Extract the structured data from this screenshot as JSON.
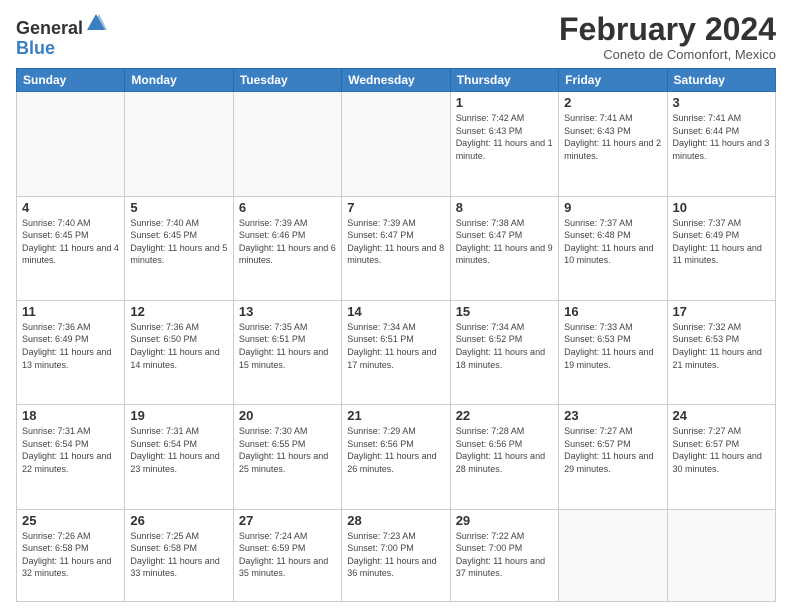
{
  "logo": {
    "general": "General",
    "blue": "Blue"
  },
  "header": {
    "title": "February 2024",
    "subtitle": "Coneto de Comonfort, Mexico"
  },
  "weekdays": [
    "Sunday",
    "Monday",
    "Tuesday",
    "Wednesday",
    "Thursday",
    "Friday",
    "Saturday"
  ],
  "weeks": [
    [
      {
        "day": "",
        "info": ""
      },
      {
        "day": "",
        "info": ""
      },
      {
        "day": "",
        "info": ""
      },
      {
        "day": "",
        "info": ""
      },
      {
        "day": "1",
        "info": "Sunrise: 7:42 AM\nSunset: 6:43 PM\nDaylight: 11 hours and 1 minute."
      },
      {
        "day": "2",
        "info": "Sunrise: 7:41 AM\nSunset: 6:43 PM\nDaylight: 11 hours and 2 minutes."
      },
      {
        "day": "3",
        "info": "Sunrise: 7:41 AM\nSunset: 6:44 PM\nDaylight: 11 hours and 3 minutes."
      }
    ],
    [
      {
        "day": "4",
        "info": "Sunrise: 7:40 AM\nSunset: 6:45 PM\nDaylight: 11 hours and 4 minutes."
      },
      {
        "day": "5",
        "info": "Sunrise: 7:40 AM\nSunset: 6:45 PM\nDaylight: 11 hours and 5 minutes."
      },
      {
        "day": "6",
        "info": "Sunrise: 7:39 AM\nSunset: 6:46 PM\nDaylight: 11 hours and 6 minutes."
      },
      {
        "day": "7",
        "info": "Sunrise: 7:39 AM\nSunset: 6:47 PM\nDaylight: 11 hours and 8 minutes."
      },
      {
        "day": "8",
        "info": "Sunrise: 7:38 AM\nSunset: 6:47 PM\nDaylight: 11 hours and 9 minutes."
      },
      {
        "day": "9",
        "info": "Sunrise: 7:37 AM\nSunset: 6:48 PM\nDaylight: 11 hours and 10 minutes."
      },
      {
        "day": "10",
        "info": "Sunrise: 7:37 AM\nSunset: 6:49 PM\nDaylight: 11 hours and 11 minutes."
      }
    ],
    [
      {
        "day": "11",
        "info": "Sunrise: 7:36 AM\nSunset: 6:49 PM\nDaylight: 11 hours and 13 minutes."
      },
      {
        "day": "12",
        "info": "Sunrise: 7:36 AM\nSunset: 6:50 PM\nDaylight: 11 hours and 14 minutes."
      },
      {
        "day": "13",
        "info": "Sunrise: 7:35 AM\nSunset: 6:51 PM\nDaylight: 11 hours and 15 minutes."
      },
      {
        "day": "14",
        "info": "Sunrise: 7:34 AM\nSunset: 6:51 PM\nDaylight: 11 hours and 17 minutes."
      },
      {
        "day": "15",
        "info": "Sunrise: 7:34 AM\nSunset: 6:52 PM\nDaylight: 11 hours and 18 minutes."
      },
      {
        "day": "16",
        "info": "Sunrise: 7:33 AM\nSunset: 6:53 PM\nDaylight: 11 hours and 19 minutes."
      },
      {
        "day": "17",
        "info": "Sunrise: 7:32 AM\nSunset: 6:53 PM\nDaylight: 11 hours and 21 minutes."
      }
    ],
    [
      {
        "day": "18",
        "info": "Sunrise: 7:31 AM\nSunset: 6:54 PM\nDaylight: 11 hours and 22 minutes."
      },
      {
        "day": "19",
        "info": "Sunrise: 7:31 AM\nSunset: 6:54 PM\nDaylight: 11 hours and 23 minutes."
      },
      {
        "day": "20",
        "info": "Sunrise: 7:30 AM\nSunset: 6:55 PM\nDaylight: 11 hours and 25 minutes."
      },
      {
        "day": "21",
        "info": "Sunrise: 7:29 AM\nSunset: 6:56 PM\nDaylight: 11 hours and 26 minutes."
      },
      {
        "day": "22",
        "info": "Sunrise: 7:28 AM\nSunset: 6:56 PM\nDaylight: 11 hours and 28 minutes."
      },
      {
        "day": "23",
        "info": "Sunrise: 7:27 AM\nSunset: 6:57 PM\nDaylight: 11 hours and 29 minutes."
      },
      {
        "day": "24",
        "info": "Sunrise: 7:27 AM\nSunset: 6:57 PM\nDaylight: 11 hours and 30 minutes."
      }
    ],
    [
      {
        "day": "25",
        "info": "Sunrise: 7:26 AM\nSunset: 6:58 PM\nDaylight: 11 hours and 32 minutes."
      },
      {
        "day": "26",
        "info": "Sunrise: 7:25 AM\nSunset: 6:58 PM\nDaylight: 11 hours and 33 minutes."
      },
      {
        "day": "27",
        "info": "Sunrise: 7:24 AM\nSunset: 6:59 PM\nDaylight: 11 hours and 35 minutes."
      },
      {
        "day": "28",
        "info": "Sunrise: 7:23 AM\nSunset: 7:00 PM\nDaylight: 11 hours and 36 minutes."
      },
      {
        "day": "29",
        "info": "Sunrise: 7:22 AM\nSunset: 7:00 PM\nDaylight: 11 hours and 37 minutes."
      },
      {
        "day": "",
        "info": ""
      },
      {
        "day": "",
        "info": ""
      }
    ]
  ]
}
